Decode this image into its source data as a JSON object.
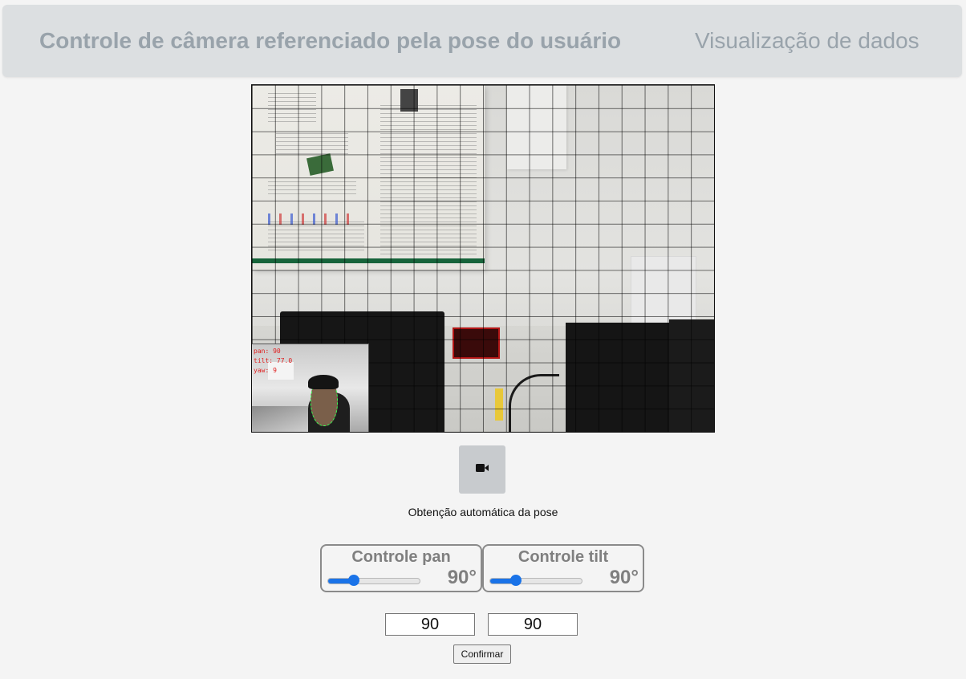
{
  "header": {
    "tabs": [
      {
        "label": "Controle de câmera referenciado pela pose do usuário",
        "active": true
      },
      {
        "label": "Visualização de dados",
        "active": false
      }
    ]
  },
  "video": {
    "overlay": {
      "pan": "pan: 90",
      "tilt": "tilt: 77.0",
      "yaw": "yaw: 9"
    }
  },
  "camera_button": {
    "icon": "video-camera-icon"
  },
  "auto_pose_label": "Obtenção automática da pose",
  "pan_control": {
    "title": "Controle pan",
    "value": 90,
    "max": 360,
    "value_label": "90°"
  },
  "tilt_control": {
    "title": "Controle tilt",
    "value": 90,
    "max": 360,
    "value_label": "90°"
  },
  "inputs": {
    "pan_value": "90",
    "tilt_value": "90"
  },
  "confirm_label": "Confirmar",
  "colors": {
    "accent": "#1a73e8",
    "tab_text": "#99a3ab",
    "tab_bar": "#dcdfe1"
  }
}
